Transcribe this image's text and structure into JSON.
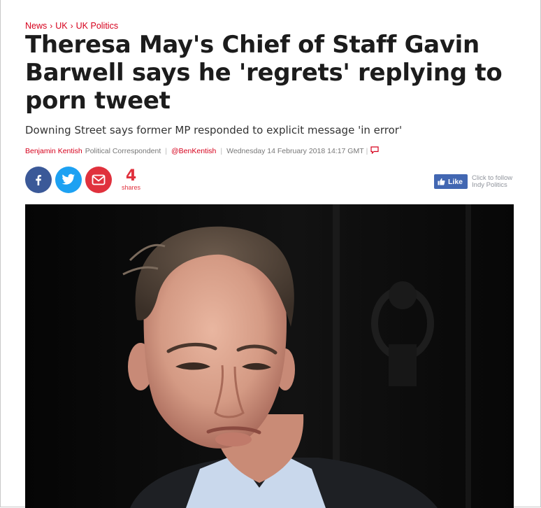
{
  "breadcrumb": [
    "News",
    "UK",
    "UK Politics"
  ],
  "article": {
    "headline": "Theresa May's Chief of Staff Gavin Barwell says he 'regrets' replying to porn tweet",
    "standfirst": "Downing Street says former MP responded to explicit message 'in error'",
    "author": "Benjamin Kentish",
    "role": "Political Correspondent",
    "handle": "@BenKentish",
    "date": "Wednesday 14 February 2018 14:17 GMT"
  },
  "share": {
    "icons": [
      "facebook-icon",
      "twitter-icon",
      "email-icon"
    ],
    "count": "4",
    "count_label": "shares"
  },
  "follow": {
    "like_label": "Like",
    "text": "Click to follow Indy Politics"
  },
  "colors": {
    "accent": "#d6001c",
    "facebook": "#3b5998",
    "twitter": "#1da1f2",
    "email": "#e0313d",
    "fb_like": "#4267b2"
  }
}
